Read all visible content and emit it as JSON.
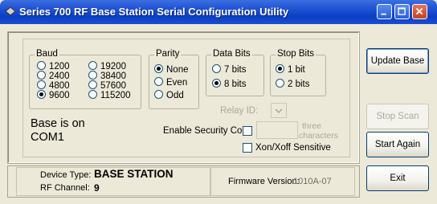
{
  "window": {
    "title": "Series 700 RF Base Station Serial Configuration Utility"
  },
  "baud": {
    "legend": "Baud",
    "options": [
      "1200",
      "2400",
      "4800",
      "9600",
      "19200",
      "38400",
      "57600",
      "115200"
    ],
    "selected": "9600"
  },
  "parity": {
    "legend": "Parity",
    "options": [
      "None",
      "Even",
      "Odd"
    ],
    "selected": "None"
  },
  "data_bits": {
    "legend": "Data Bits",
    "options": [
      "7 bits",
      "8 bits"
    ],
    "selected": "8 bits"
  },
  "stop_bits": {
    "legend": "Stop Bits",
    "options": [
      "1 bit",
      "2 bits"
    ],
    "selected": "1 bit"
  },
  "relay": {
    "label": "Relay ID:"
  },
  "status": {
    "line1": "Base is on",
    "line2": "COM1"
  },
  "security": {
    "label": "Enable Security Code",
    "hint_line1": "three",
    "hint_line2": "characters",
    "checked": false
  },
  "xon": {
    "label": "Xon/Xoff Sensitive",
    "checked": false
  },
  "info": {
    "device_type_label": "Device Type:",
    "device_type_value": "BASE STATION",
    "rf_channel_label": "RF Channel:",
    "rf_channel_value": "9",
    "firmware_label": "Firmware Version:",
    "firmware_value": "1010A-07"
  },
  "buttons": {
    "update": "Update Base",
    "stop_scan": "Stop Scan",
    "start_again": "Start Again",
    "exit": "Exit"
  },
  "colors": {
    "titlebar": "#0a3fc4",
    "face": "#ece9d8"
  }
}
